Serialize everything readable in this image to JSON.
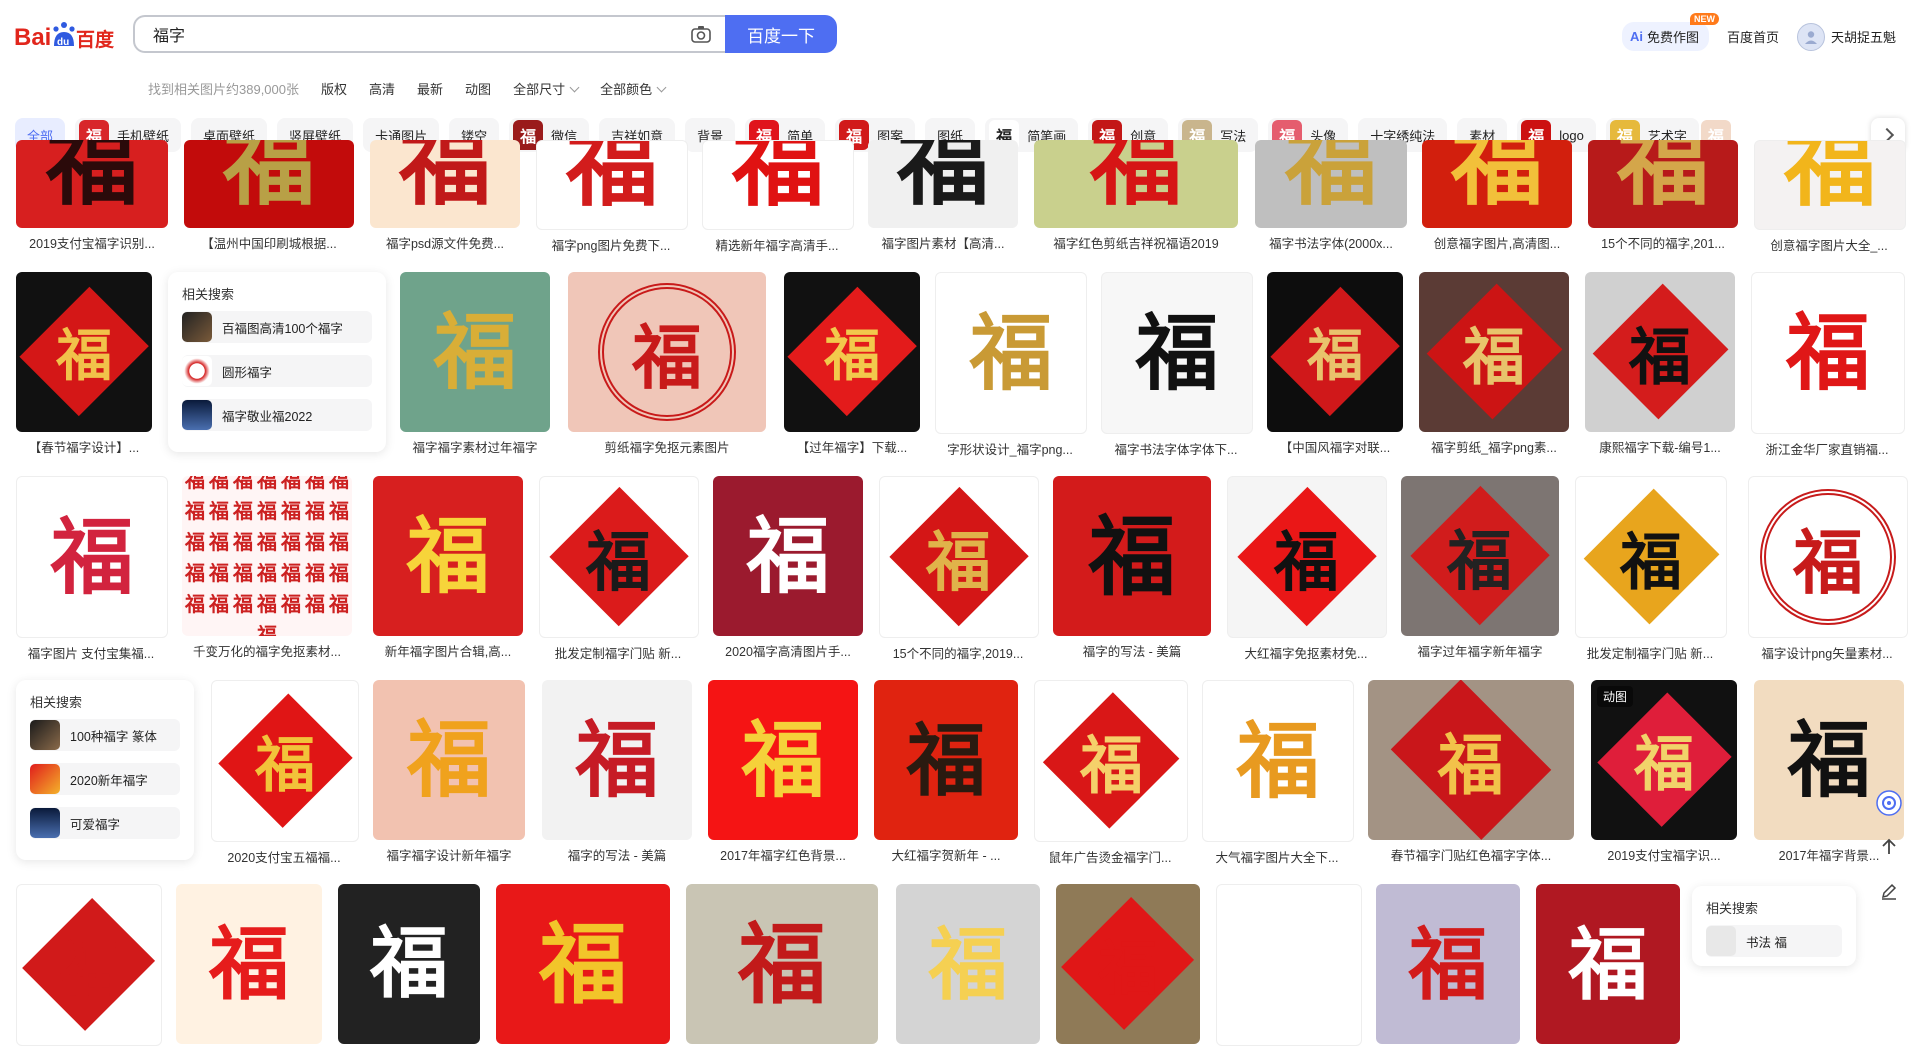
{
  "search": {
    "query": "福字",
    "button": "百度一下"
  },
  "header": {
    "ai_label": "免费作图",
    "ai_badge": "NEW",
    "home": "百度首页",
    "username": "天胡捉五魁"
  },
  "filters": [
    "找到相关图片约389,000张",
    "版权",
    "高清",
    "最新",
    "动图",
    "全部尺寸",
    "全部颜色"
  ],
  "tags": [
    {
      "label": "全部"
    },
    {
      "label": "手机壁纸",
      "thumb": "#d8262a"
    },
    {
      "label": "桌面壁纸"
    },
    {
      "label": "竖屏壁纸"
    },
    {
      "label": "卡通图片"
    },
    {
      "label": "镂空"
    },
    {
      "label": "微信",
      "thumb": "#9a1b1b"
    },
    {
      "label": "吉祥如意"
    },
    {
      "label": "背景"
    },
    {
      "label": "简单",
      "thumb": "#e0141c"
    },
    {
      "label": "图案",
      "thumb": "#d11a1a"
    },
    {
      "label": "图纸"
    },
    {
      "label": "简笔画",
      "thumb": "#ffffff"
    },
    {
      "label": "创意",
      "thumb": "#c31717"
    },
    {
      "label": "写法",
      "thumb": "#c9b58d"
    },
    {
      "label": "头像",
      "thumb": "#e55d6e"
    },
    {
      "label": "十字绣纯法"
    },
    {
      "label": "素材"
    },
    {
      "label": "logo",
      "thumb": "#cc1111"
    },
    {
      "label": "艺术字",
      "thumb": "#e6b93c"
    },
    {
      "label": "",
      "thumb": "#f2d9c8"
    }
  ],
  "rows": [
    [
      {
        "cap": "2019支付宝福字识别...",
        "bg": "#d71f1f",
        "fg": "#2b0a0a",
        "style": "cut"
      },
      {
        "cap": "【温州中国印刷城根据...",
        "bg": "#c20b0b",
        "fg": "#b8a046",
        "style": "cut"
      },
      {
        "cap": "福字psd源文件免费...",
        "bg": "#fbe6cf",
        "fg": "#c11919",
        "style": "cut"
      },
      {
        "cap": "福字png图片免费下...",
        "bg": "#ffffff",
        "fg": "#d21c1c",
        "style": "cut"
      },
      {
        "cap": "精选新年福字高清手...",
        "bg": "#ffffff",
        "fg": "#e01212",
        "style": "cut"
      },
      {
        "cap": "福字图片素材【高清...",
        "bg": "#f0f0f0",
        "fg": "#1a1a1a",
        "style": "cut"
      },
      {
        "cap": "福字红色剪纸吉祥祝福语2019",
        "bg": "#c9d08d",
        "fg": "#d61515",
        "style": "cut"
      },
      {
        "cap": "福字书法字体(2000x...",
        "bg": "#bfbfbf",
        "fg": "#caa23a",
        "style": "cut"
      },
      {
        "cap": "创意福字图片,高清图...",
        "bg": "#d21f0d",
        "fg": "#f2c03a",
        "style": "cut"
      },
      {
        "cap": "15个不同的福字,201...",
        "bg": "#b71a1a",
        "fg": "#d4a64a",
        "style": "cut"
      },
      {
        "cap": "创意福字图片大全_...",
        "bg": "#f4f2f2",
        "fg": "#f2b51b",
        "style": "cut"
      }
    ],
    [
      {
        "cap": "【春节福字设计】...",
        "bg": "#111111",
        "fg": "#f1c24a",
        "style": "diamond",
        "inner": "#d41717"
      },
      {
        "cap": "福字福字素材过年福字",
        "bg": "#6fa38b",
        "fg": "#d9ae37",
        "style": "plain"
      },
      {
        "cap": "剪纸福字免抠元素图片",
        "bg": "#f0c6b8",
        "fg": "#c81a1a",
        "style": "ring"
      },
      {
        "cap": "【过年福字】下载...",
        "bg": "#111111",
        "fg": "#f2c94c",
        "style": "diamond",
        "inner": "#e31b1b"
      },
      {
        "cap": "字形状设计_福字png...",
        "bg": "#ffffff",
        "fg": "#c99a35",
        "style": "plain"
      },
      {
        "cap": "福字书法字体字体下...",
        "bg": "#f7f7f7",
        "fg": "#111111",
        "style": "plain"
      },
      {
        "cap": "【中国风福字对联...",
        "bg": "#0d0d0d",
        "fg": "#e9c26c",
        "style": "diamond",
        "inner": "#d0181a"
      },
      {
        "cap": "福字剪纸_福字png素...",
        "bg": "#5b3b35",
        "fg": "#e8c46b",
        "style": "diamond",
        "inner": "#cc1414"
      },
      {
        "cap": "康熙福字下载-编号1...",
        "bg": "#d0d0d0",
        "fg": "#111111",
        "style": "diamond",
        "inner": "#d41c1c"
      },
      {
        "cap": "浙江金华厂家直销福...",
        "bg": "#ffffff",
        "fg": "#e01717",
        "style": "plain"
      }
    ],
    [
      {
        "cap": "福字图片 支付宝集福...",
        "bg": "#ffffff",
        "fg": "#d2233e",
        "style": "plain"
      },
      {
        "cap": "千变万化的福字免抠素材...",
        "bg": "#fff5f5",
        "fg": "#cc2121",
        "style": "many"
      },
      {
        "cap": "新年福字图片合辑,高...",
        "bg": "#d71f1f",
        "fg": "#f7d43a",
        "style": "plain"
      },
      {
        "cap": "批发定制福字门贴 新...",
        "bg": "#ffffff",
        "fg": "#1a1a1a",
        "style": "diamond",
        "inner": "#db1b1b"
      },
      {
        "cap": "2020福字高清图片手...",
        "bg": "#9b1a2e",
        "fg": "#ffffff",
        "style": "plain"
      },
      {
        "cap": "15个不同的福字,2019...",
        "bg": "#ffffff",
        "fg": "#e0b34a",
        "style": "diamond",
        "inner": "#d41616"
      },
      {
        "cap": "福字的写法 - 美篇",
        "bg": "#d31b1b",
        "fg": "#111111",
        "style": "plain"
      },
      {
        "cap": "大红福字免抠素材免...",
        "bg": "#f5f5f5",
        "fg": "#111111",
        "style": "diamond",
        "inner": "#ea1717"
      },
      {
        "cap": "福字过年福字新年福字",
        "bg": "#7d7572",
        "fg": "#222222",
        "style": "diamond",
        "inner": "#d11c1c"
      },
      {
        "cap": "批发定制福字门贴 新...",
        "bg": "#ffffff",
        "fg": "#111111",
        "style": "diamond",
        "inner": "#e8a51d"
      },
      {
        "cap": "福字设计png矢量素材...",
        "bg": "#ffffff",
        "fg": "#c71b1b",
        "style": "ring"
      }
    ],
    [
      {
        "cap": "2020支付宝五福福...",
        "bg": "#ffffff",
        "fg": "#f2c33a",
        "style": "diamond",
        "inner": "#e01515"
      },
      {
        "cap": "福字福字设计新年福字",
        "bg": "#f2c2b0",
        "fg": "#f0a21d",
        "style": "plain"
      },
      {
        "cap": "福字的写法 - 美篇",
        "bg": "#f2f2f2",
        "fg": "#c61b25",
        "style": "plain"
      },
      {
        "cap": "2017年福字红色背景...",
        "bg": "#f51414",
        "fg": "#f5d13a",
        "style": "plain"
      },
      {
        "cap": "大红福字贺新年 - ...",
        "bg": "#e02310",
        "fg": "#2a1a10",
        "style": "plain"
      },
      {
        "cap": "鼠年广告烫金福字门...",
        "bg": "#ffffff",
        "fg": "#f5d06a",
        "style": "diamond",
        "inner": "#d91717"
      },
      {
        "cap": "大气福字图片大全下...",
        "bg": "#ffffff",
        "fg": "#e89a20",
        "style": "plain"
      },
      {
        "cap": "春节福字门贴红色福字字体...",
        "bg": "#a39384",
        "fg": "#f2c24a",
        "style": "diamond",
        "inner": "#c9161a"
      },
      {
        "cap": "2019支付宝福字识...",
        "bg": "#111111",
        "fg": "#f1d36a",
        "style": "diamond",
        "inner": "#df1e3a",
        "gif": "动图"
      },
      {
        "cap": "2017年福字背景...",
        "bg": "#f2dcc0",
        "fg": "#111111",
        "style": "plain"
      }
    ],
    [
      {
        "cap": "",
        "bg": "#ffffff",
        "fg": "#d11a1a",
        "style": "diamond",
        "inner": "#d11a1a"
      },
      {
        "cap": "",
        "bg": "#fff2e2",
        "fg": "#e61c1c",
        "style": "plain"
      },
      {
        "cap": "",
        "bg": "#222222",
        "fg": "#ffffff",
        "style": "plain"
      },
      {
        "cap": "",
        "bg": "#e81818",
        "fg": "#f2c52a",
        "style": "plain"
      },
      {
        "cap": "",
        "bg": "#c9c5b4",
        "fg": "#c21a1a",
        "style": "plain"
      },
      {
        "cap": "",
        "bg": "#d4d4d4",
        "fg": "#f5d052",
        "style": "plain"
      },
      {
        "cap": "",
        "bg": "#8f7a57",
        "fg": "#e01717",
        "style": "diamond",
        "inner": "#e01717"
      },
      {
        "cap": "",
        "bg": "#ffffff",
        "fg": "#ffffff",
        "style": "plain"
      },
      {
        "cap": "",
        "bg": "#c0bbd4",
        "fg": "#d21a1a",
        "style": "plain"
      },
      {
        "cap": "",
        "bg": "#b01822",
        "fg": "#ffffff",
        "style": "plain"
      }
    ]
  ],
  "char": "福",
  "related_1": {
    "title": "相关搜索",
    "items": [
      "百福图高清100个福字",
      "圆形福字",
      "福字敬业福2022"
    ]
  },
  "related_2": {
    "title": "相关搜索",
    "items": [
      "100种福字 篆体",
      "2020新年福字",
      "可爱福字"
    ]
  },
  "related_3": {
    "title": "相关搜索",
    "items": [
      "书法 福"
    ]
  }
}
